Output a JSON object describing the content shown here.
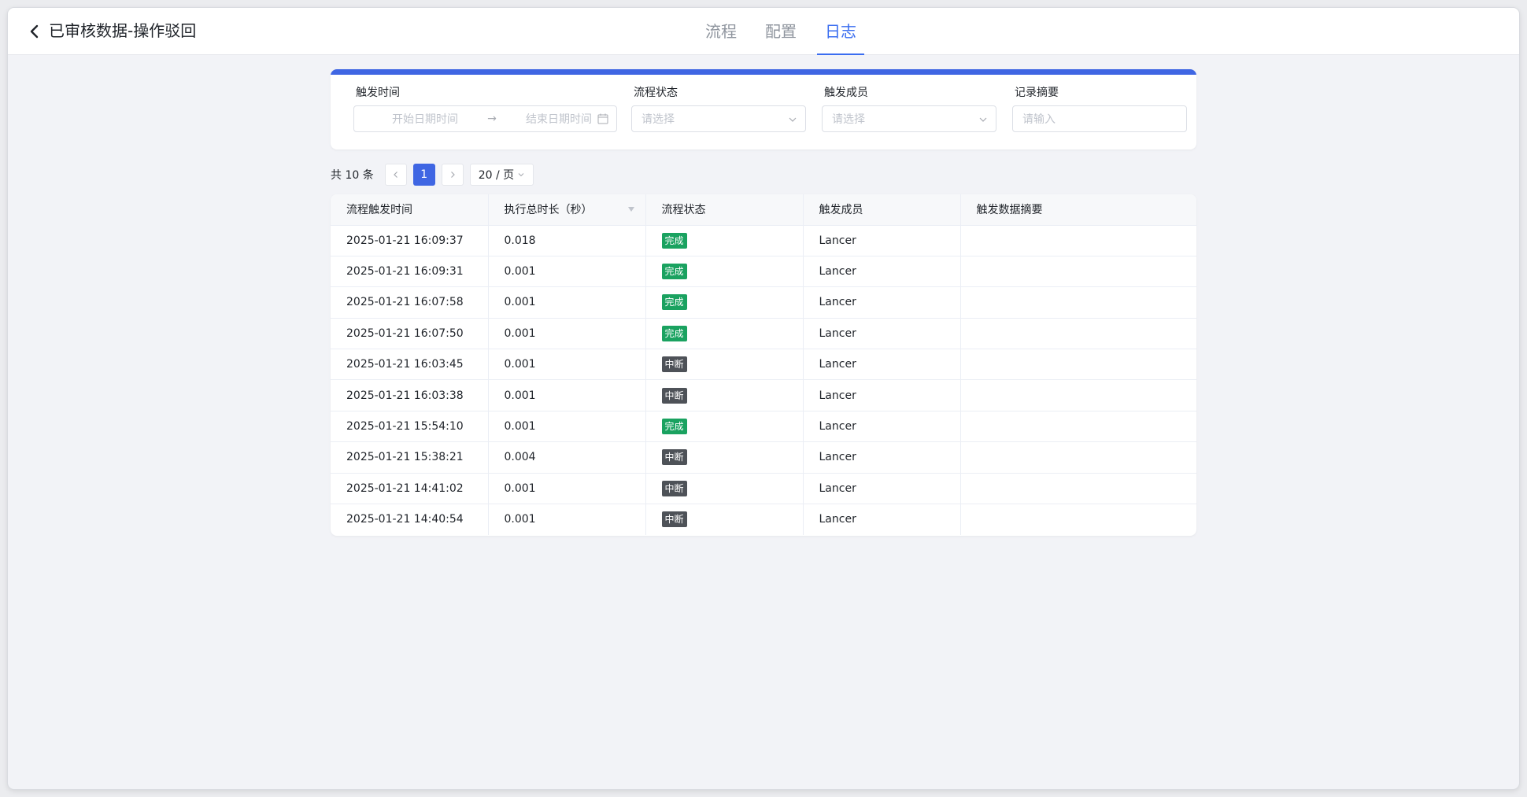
{
  "header": {
    "title": "已审核数据-操作驳回",
    "tabs": [
      {
        "label": "流程",
        "active": false
      },
      {
        "label": "配置",
        "active": false
      },
      {
        "label": "日志",
        "active": true
      }
    ]
  },
  "filters": {
    "trigger_time": {
      "label": "触发时间",
      "start_placeholder": "开始日期时间",
      "arrow": "→",
      "end_placeholder": "结束日期时间"
    },
    "flow_status": {
      "label": "流程状态",
      "placeholder": "请选择"
    },
    "trigger_member": {
      "label": "触发成员",
      "placeholder": "请选择"
    },
    "record_summary": {
      "label": "记录摘要",
      "placeholder": "请输入"
    }
  },
  "pagination": {
    "total_text": "共 10 条",
    "current_page": "1",
    "page_size": "20 / 页"
  },
  "table": {
    "columns": [
      "流程触发时间",
      "执行总时长（秒）",
      "流程状态",
      "触发成员",
      "触发数据摘要"
    ],
    "rows": [
      {
        "time": "2025-01-21 16:09:37",
        "duration": "0.018",
        "status": "完成",
        "member": "Lancer",
        "summary": ""
      },
      {
        "time": "2025-01-21 16:09:31",
        "duration": "0.001",
        "status": "完成",
        "member": "Lancer",
        "summary": ""
      },
      {
        "time": "2025-01-21 16:07:58",
        "duration": "0.001",
        "status": "完成",
        "member": "Lancer",
        "summary": ""
      },
      {
        "time": "2025-01-21 16:07:50",
        "duration": "0.001",
        "status": "完成",
        "member": "Lancer",
        "summary": ""
      },
      {
        "time": "2025-01-21 16:03:45",
        "duration": "0.001",
        "status": "中断",
        "member": "Lancer",
        "summary": ""
      },
      {
        "time": "2025-01-21 16:03:38",
        "duration": "0.001",
        "status": "中断",
        "member": "Lancer",
        "summary": ""
      },
      {
        "time": "2025-01-21 15:54:10",
        "duration": "0.001",
        "status": "完成",
        "member": "Lancer",
        "summary": ""
      },
      {
        "time": "2025-01-21 15:38:21",
        "duration": "0.004",
        "status": "中断",
        "member": "Lancer",
        "summary": ""
      },
      {
        "time": "2025-01-21 14:41:02",
        "duration": "0.001",
        "status": "中断",
        "member": "Lancer",
        "summary": ""
      },
      {
        "time": "2025-01-21 14:40:54",
        "duration": "0.001",
        "status": "中断",
        "member": "Lancer",
        "summary": ""
      }
    ]
  },
  "status_colors": {
    "完成": "#1aa260",
    "中断": "#4e5258"
  },
  "theme": {
    "accent": "#3f66e3"
  },
  "icons": {
    "back": "chevron-left-icon",
    "calendar": "calendar-icon",
    "dropdown": "chevron-down-icon",
    "prev": "chevron-left-icon",
    "next": "chevron-right-icon",
    "sort": "sort-caret-icon"
  }
}
